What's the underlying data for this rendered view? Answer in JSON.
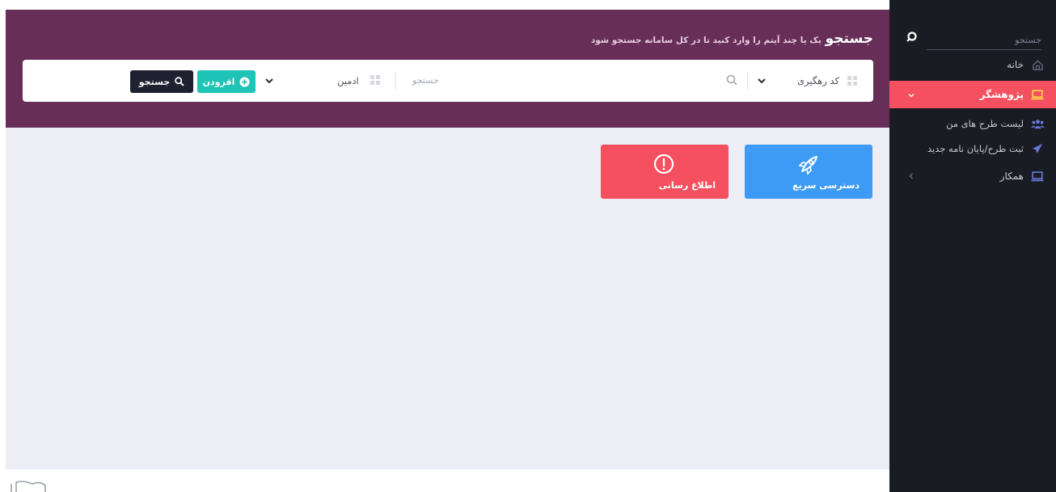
{
  "sidebar": {
    "search_placeholder": "جستجو",
    "items": [
      {
        "label": "خانه",
        "icon": "home-icon"
      },
      {
        "label": "پژوهشگر",
        "icon": "laptop-icon",
        "active": true
      },
      {
        "label": "لیست طرح های من",
        "icon": "users-icon"
      },
      {
        "label": "ثبت طرح/پایان نامه جدید",
        "icon": "paper-plane-icon"
      },
      {
        "label": "همکار",
        "icon": "laptop-icon"
      }
    ]
  },
  "header": {
    "title": "جستجو",
    "subtitle": "یک یا چند آیتم را وارد کنید تا در کل سامانه جستجو شود"
  },
  "searchbar": {
    "field1_label": "کد رهگیری",
    "search_placeholder": "جستجو",
    "field2_label": "ادمین",
    "add_label": "افزودن",
    "search_label": "جستجو"
  },
  "cards": {
    "quick_access": "دسترسی سریع",
    "notification": "اطلاع رسانی"
  },
  "colors": {
    "header_bg": "#672f58",
    "sidebar_bg": "#1a1c24",
    "active_item": "#f4505f",
    "add_button": "#1ec4b7",
    "quick_card": "#3d9bf5",
    "notify_card": "#f4505f"
  }
}
